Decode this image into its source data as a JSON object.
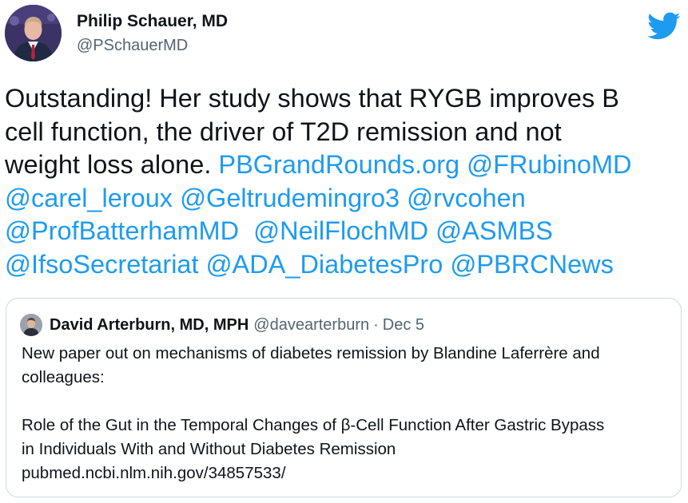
{
  "tweet": {
    "author": {
      "name": "Philip Schauer, MD",
      "handle": "@PSchauerMD",
      "avatar_icon": "profile-photo"
    },
    "brand_icon": "twitter-bird-icon",
    "brand_color": "#1d9bf0",
    "text": {
      "line1": "Outstanding! Her study shows that RYGB improves B",
      "line2": "cell function, the driver of T2D remission and not",
      "line3_text": "weight loss alone. ",
      "links": [
        "PBGrandRounds.org",
        "@FRubinoMD",
        "@carel_leroux",
        "@Geltrudemingro3",
        "@rvcohen",
        "@ProfBatterhamMD",
        "@NeilFlochMD",
        "@ASMBS",
        "@IfsoSecretariat",
        "@ADA_DiabetesPro",
        "@PBRCNews"
      ]
    }
  },
  "quote": {
    "author_name": "David Arterburn, MD, MPH",
    "author_handle": "@davearterburn",
    "separator": "·",
    "date": "Dec 5",
    "body": {
      "line1": "New paper out on mechanisms of diabetes remission by Blandine Laferrère and",
      "line2": "colleagues:",
      "line3": "Role of the Gut in the Temporal Changes of β-Cell Function After Gastric Bypass",
      "line4": "in Individuals With and Without Diabetes Remission",
      "link": "pubmed.ncbi.nlm.nih.gov/34857533/"
    }
  },
  "colors": {
    "text": "#0f1419",
    "secondary": "#536471",
    "link": "#1d9bf0",
    "border": "#cfd9de"
  }
}
